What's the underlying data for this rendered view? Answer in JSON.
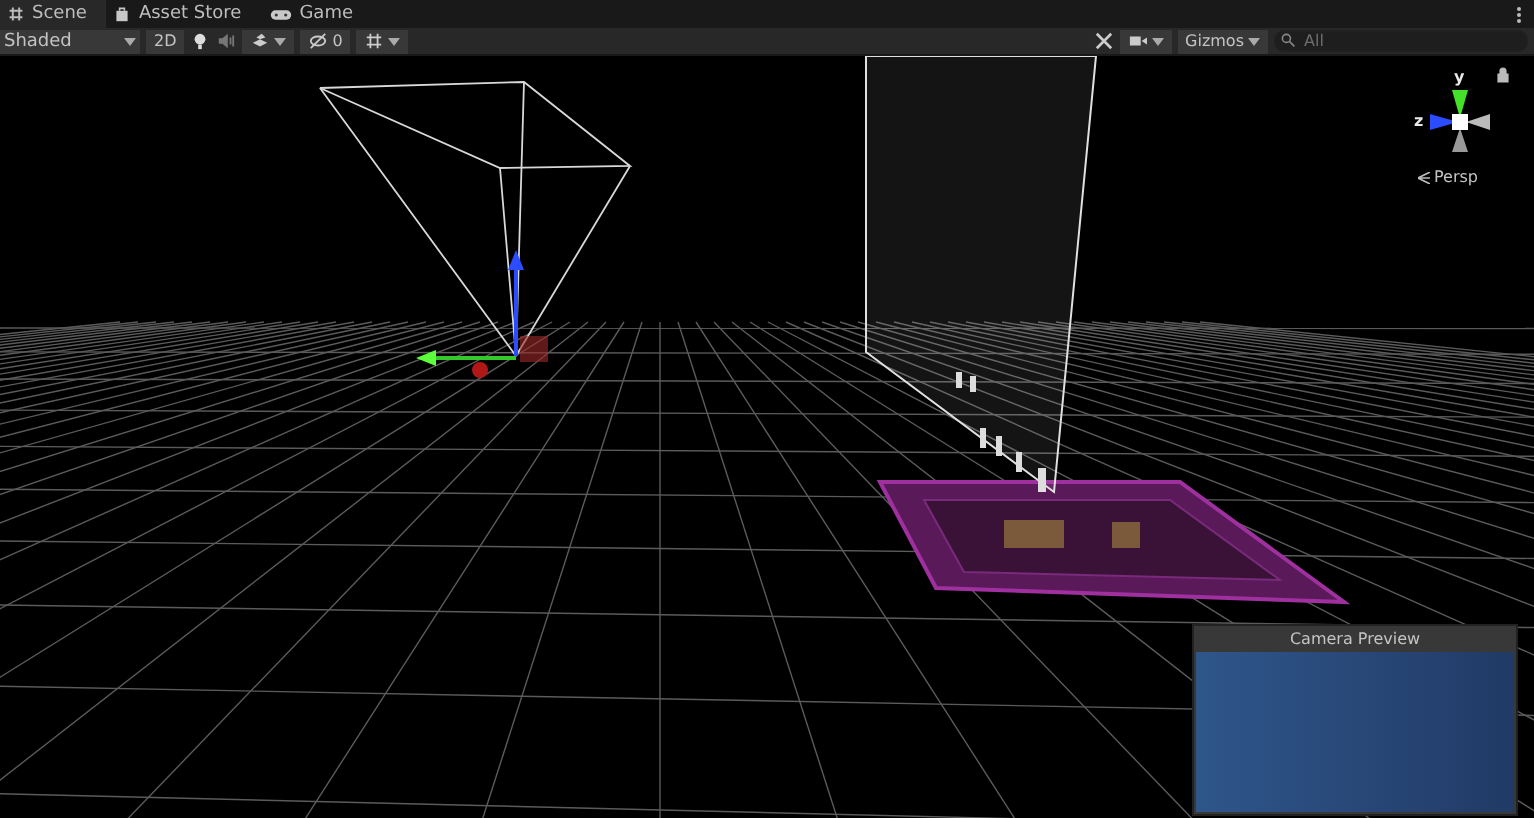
{
  "tabs": [
    {
      "label": "Scene",
      "kind": "grid",
      "selected": true
    },
    {
      "label": "Asset Store",
      "kind": "bag",
      "selected": false
    },
    {
      "label": "Game",
      "kind": "gamepad",
      "selected": false
    }
  ],
  "toolbar": {
    "draw_mode": "Shaded",
    "mode_2d": "2D",
    "hidden_count": "0",
    "gizmos": "Gizmos",
    "search": {
      "placeholder": "All"
    }
  },
  "orientation_gizmo": {
    "y_label": "y",
    "z_label": "z",
    "projection": "Persp"
  },
  "camera_preview": {
    "title": "Camera Preview"
  }
}
